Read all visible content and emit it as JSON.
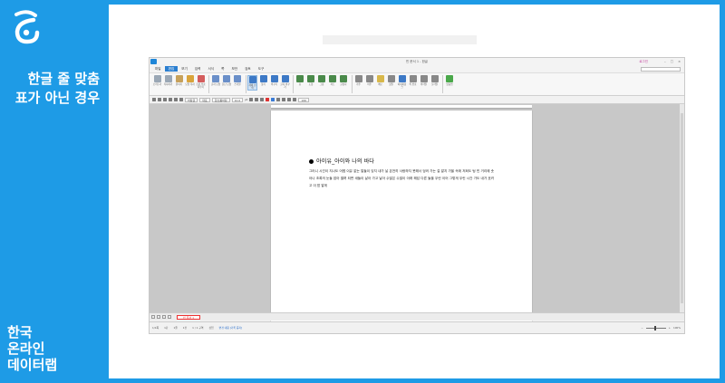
{
  "sidebar": {
    "title_line1": "한글 줄 맞춤",
    "title_line2": "표가 아닌 경우",
    "org_line1": "한국",
    "org_line2": "온라인",
    "org_line3": "데이터랩"
  },
  "app": {
    "window_title": "빈 문서 1 - 한글",
    "user_label": "로그인",
    "menu": [
      "파일",
      "편집",
      "보기",
      "입력",
      "서식",
      "쪽",
      "보안",
      "검토",
      "도구"
    ],
    "active_menu": "편집",
    "ribbon": [
      {
        "label": "오려두기",
        "icon": "scissors-icon",
        "color": "#9aa7b5"
      },
      {
        "label": "복사하기",
        "icon": "copy-icon",
        "color": "#9aa7b5"
      },
      {
        "label": "붙이기",
        "icon": "paste-icon",
        "color": "#c7a15a"
      },
      {
        "label": "모양 복사",
        "icon": "format-painter-icon",
        "color": "#d9a43b"
      },
      {
        "label": "조판 부호 지우기",
        "icon": "eraser-icon",
        "color": "#d45d5d"
      },
      {
        "label": "글자 모양",
        "icon": "char-shape-icon",
        "color": "#6a8fc9"
      },
      {
        "label": "문단 모양",
        "icon": "para-shape-icon",
        "color": "#6a8fc9"
      },
      {
        "label": "스타일",
        "icon": "style-icon",
        "color": "#6a8fc9"
      },
      {
        "label": "개체 선택",
        "icon": "select-icon",
        "color": "#3d79c6"
      },
      {
        "label": "찾기",
        "icon": "find-icon",
        "color": "#3d79c6"
      },
      {
        "label": "바꾸기",
        "icon": "replace-icon",
        "color": "#3d79c6"
      },
      {
        "label": "글자 바꾸기",
        "icon": "switch-icon",
        "color": "#3d79c6"
      },
      {
        "label": "표",
        "icon": "table-icon",
        "color": "#4a8a4a"
      },
      {
        "label": "도형",
        "icon": "shape-icon",
        "color": "#4a8a4a"
      },
      {
        "label": "그림",
        "icon": "picture-icon",
        "color": "#4a8a4a"
      },
      {
        "label": "차트",
        "icon": "chart-icon",
        "color": "#4a8a4a"
      },
      {
        "label": "글상자",
        "icon": "textbox-icon",
        "color": "#4a8a4a"
      },
      {
        "label": "각주",
        "icon": "footnote-icon",
        "color": "#888888"
      },
      {
        "label": "미주",
        "icon": "endnote-icon",
        "color": "#888888"
      },
      {
        "label": "메모",
        "icon": "memo-icon",
        "color": "#d8b84a"
      },
      {
        "label": "덧말",
        "icon": "annotation-icon",
        "color": "#888888"
      },
      {
        "label": "하이퍼링크",
        "icon": "link-icon",
        "color": "#3d79c6"
      },
      {
        "label": "쪽 번호",
        "icon": "page-number-icon",
        "color": "#888888"
      },
      {
        "label": "머리말",
        "icon": "header-icon",
        "color": "#888888"
      },
      {
        "label": "꼬리말",
        "icon": "footer-icon",
        "color": "#888888"
      },
      {
        "label": "맞춤법",
        "icon": "spellcheck-icon",
        "color": "#4aa84a"
      }
    ],
    "format_bar": {
      "style": "바탕글",
      "lang": "대표",
      "font": "함초롬바탕",
      "size": "10.0",
      "unit": "pt",
      "zoom_box": "160"
    },
    "document": {
      "title": "아이유_아이와 나의 바다",
      "body": "그러니 시간이 지나도 어쩜 이유 없는 알들이 잊지 내가 날 온전히 사랑하지 못해서 엉켜 가는 걸 알지 가을 속에 저희도 텅 빈 거리에 솟아나 초록의 눈들 잡아 떨며 되면 새들이 날아 가고 날아 수많은 수많이 아래 해답 다른 들을 우린 이어 그렇게 우린 시간 가도 내가 흐려고 이 밤 알게"
    },
    "tab": "빈 문서 1",
    "status": {
      "page": "1/1쪽",
      "section": "1단",
      "line": "1줄",
      "column": "1칸",
      "chars": "1 / 1 구역",
      "mode": "삽입",
      "change": "변경 내용 [기록 중지]",
      "zoom": "100%"
    }
  }
}
